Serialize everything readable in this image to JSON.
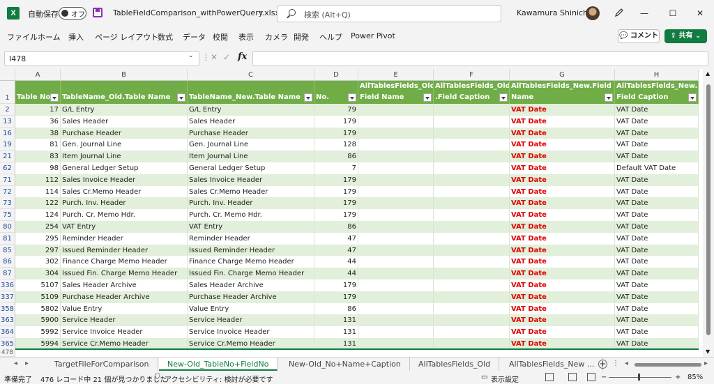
{
  "titlebar": {
    "autosave_label": "自動保存",
    "autosave_state": "オフ",
    "filename": "TableFieldComparison_withPowerQuery.xlsx",
    "search_placeholder": "検索 (Alt+Q)",
    "username": "Kawamura Shinichi"
  },
  "menu": [
    "ファイル",
    "ホーム",
    "挿入",
    "ページ レイアウト",
    "数式",
    "データ",
    "校閲",
    "表示",
    "カメラ",
    "開発",
    "ヘルプ",
    "Power Pivot"
  ],
  "buttons": {
    "comment": "コメント",
    "share": "共有"
  },
  "formula_bar": {
    "name_box": "I478",
    "fx": "fx",
    "formula": ""
  },
  "columns": [
    "A",
    "B",
    "C",
    "D",
    "E",
    "F",
    "G",
    "H"
  ],
  "header_row_number": "1",
  "headers": [
    {
      "l1": "",
      "l2": "Table No."
    },
    {
      "l1": "",
      "l2": "TableName_Old.Table Name"
    },
    {
      "l1": "",
      "l2": "TableName_New.Table Name"
    },
    {
      "l1": "",
      "l2": "No."
    },
    {
      "l1": "AllTablesFields_Old.",
      "l2": "Field Name"
    },
    {
      "l1": "AllTablesFields_Old",
      "l2": ".Field Caption"
    },
    {
      "l1": "AllTablesFields_New.Field",
      "l2": "Name"
    },
    {
      "l1": "AllTablesFields_New.",
      "l2": "Field Caption"
    }
  ],
  "rows": [
    {
      "rn": "2",
      "a": "17",
      "b": "G/L Entry",
      "c": "G/L Entry",
      "d": "79",
      "g": "VAT Date",
      "h": "VAT Date"
    },
    {
      "rn": "13",
      "a": "36",
      "b": "Sales Header",
      "c": "Sales Header",
      "d": "179",
      "g": "VAT Date",
      "h": "VAT Date"
    },
    {
      "rn": "16",
      "a": "38",
      "b": "Purchase Header",
      "c": "Purchase Header",
      "d": "179",
      "g": "VAT Date",
      "h": "VAT Date"
    },
    {
      "rn": "19",
      "a": "81",
      "b": "Gen. Journal Line",
      "c": "Gen. Journal Line",
      "d": "128",
      "g": "VAT Date",
      "h": "VAT Date"
    },
    {
      "rn": "21",
      "a": "83",
      "b": "Item Journal Line",
      "c": "Item Journal Line",
      "d": "86",
      "g": "VAT Date",
      "h": "VAT Date"
    },
    {
      "rn": "62",
      "a": "98",
      "b": "General Ledger Setup",
      "c": "General Ledger Setup",
      "d": "7",
      "g": "VAT Date",
      "h": "Default VAT Date"
    },
    {
      "rn": "71",
      "a": "112",
      "b": "Sales Invoice Header",
      "c": "Sales Invoice Header",
      "d": "179",
      "g": "VAT Date",
      "h": "VAT Date"
    },
    {
      "rn": "72",
      "a": "114",
      "b": "Sales Cr.Memo Header",
      "c": "Sales Cr.Memo Header",
      "d": "179",
      "g": "VAT Date",
      "h": "VAT Date"
    },
    {
      "rn": "73",
      "a": "122",
      "b": "Purch. Inv. Header",
      "c": "Purch. Inv. Header",
      "d": "179",
      "g": "VAT Date",
      "h": "VAT Date"
    },
    {
      "rn": "75",
      "a": "124",
      "b": "Purch. Cr. Memo Hdr.",
      "c": "Purch. Cr. Memo Hdr.",
      "d": "179",
      "g": "VAT Date",
      "h": "VAT Date"
    },
    {
      "rn": "80",
      "a": "254",
      "b": "VAT Entry",
      "c": "VAT Entry",
      "d": "86",
      "g": "VAT Date",
      "h": "VAT Date"
    },
    {
      "rn": "81",
      "a": "295",
      "b": "Reminder Header",
      "c": "Reminder Header",
      "d": "47",
      "g": "VAT Date",
      "h": "VAT Date"
    },
    {
      "rn": "85",
      "a": "297",
      "b": "Issued Reminder Header",
      "c": "Issued Reminder Header",
      "d": "47",
      "g": "VAT Date",
      "h": "VAT Date"
    },
    {
      "rn": "86",
      "a": "302",
      "b": "Finance Charge Memo Header",
      "c": "Finance Charge Memo Header",
      "d": "44",
      "g": "VAT Date",
      "h": "VAT Date"
    },
    {
      "rn": "87",
      "a": "304",
      "b": "Issued Fin. Charge Memo Header",
      "c": "Issued Fin. Charge Memo Header",
      "d": "44",
      "g": "VAT Date",
      "h": "VAT Date"
    },
    {
      "rn": "336",
      "a": "5107",
      "b": "Sales Header Archive",
      "c": "Sales Header Archive",
      "d": "179",
      "g": "VAT Date",
      "h": "VAT Date"
    },
    {
      "rn": "337",
      "a": "5109",
      "b": "Purchase Header Archive",
      "c": "Purchase Header Archive",
      "d": "179",
      "g": "VAT Date",
      "h": "VAT Date"
    },
    {
      "rn": "358",
      "a": "5802",
      "b": "Value Entry",
      "c": "Value Entry",
      "d": "86",
      "g": "VAT Date",
      "h": "VAT Date"
    },
    {
      "rn": "363",
      "a": "5900",
      "b": "Service Header",
      "c": "Service Header",
      "d": "131",
      "g": "VAT Date",
      "h": "VAT Date"
    },
    {
      "rn": "364",
      "a": "5992",
      "b": "Service Invoice Header",
      "c": "Service Invoice Header",
      "d": "131",
      "g": "VAT Date",
      "h": "VAT Date"
    },
    {
      "rn": "365",
      "a": "5994",
      "b": "Service Cr.Memo Header",
      "c": "Service Cr.Memo Header",
      "d": "131",
      "g": "VAT Date",
      "h": "VAT Date"
    }
  ],
  "last_row_number": "478",
  "sheet_tabs": [
    "TargetFileForComparison",
    "New-Old_TableNo+FieldNo",
    "New-Old_No+Name+Caption",
    "AllTablesFields_Old",
    "AllTablesFields_New ..."
  ],
  "active_tab_index": 1,
  "status": {
    "ready": "準備完了",
    "found": "476 レコード中 21 個が見つかりました",
    "accessibility": "アクセシビリティ: 検討が必要です",
    "display_settings": "表示設定",
    "zoom": "85%"
  },
  "colors": {
    "accent": "#107c41",
    "header_green": "#70ad47",
    "band_green": "#e2efda",
    "red": "#e00000"
  }
}
